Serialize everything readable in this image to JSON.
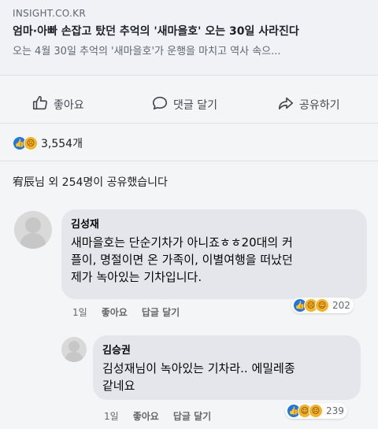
{
  "link_preview": {
    "domain": "INSIGHT.CO.KR",
    "title": "엄마·아빠 손잡고 탔던 추억의 '새마을호' 오는 30일 사라진다",
    "description": "오는 4월 30일 추억의 '새마을호'가 운행을 마치고 역사 속으..."
  },
  "actions": {
    "like": "좋아요",
    "comment": "댓글 달기",
    "share": "공유하기"
  },
  "reactions": {
    "count": "3,554개",
    "types": [
      "like-icon",
      "sad-icon"
    ]
  },
  "shares_text": "宥辰님 외 254명이 공유했습니다",
  "comments": [
    {
      "author": "김성재",
      "lines": [
        "새마을호는 단순기차가 아니죠ㅎㅎ20대의 커",
        "플이, 명절이면 온 가족이, 이별여행을 떠났던",
        "제가 녹아있는 기차입니다."
      ],
      "time": "1일",
      "like_label": "좋아요",
      "reply_label": "답글 달기",
      "reaction_count": "202",
      "reaction_types": [
        "like-icon",
        "sad-icon",
        "haha-icon"
      ]
    },
    {
      "author": "김승권",
      "lines": [
        "김성재님이 녹아있는 기차라.. 에밀레종",
        "같네요"
      ],
      "time": "1일",
      "like_label": "좋아요",
      "reply_label": "답글 달기",
      "reaction_count": "239",
      "reaction_types": [
        "like-icon",
        "haha-icon",
        "sad-icon"
      ]
    }
  ],
  "colors": {
    "like_blue": "#1877f2",
    "emoji_yellow": "#f7b125",
    "bubble_gray": "#e4e6eb"
  }
}
